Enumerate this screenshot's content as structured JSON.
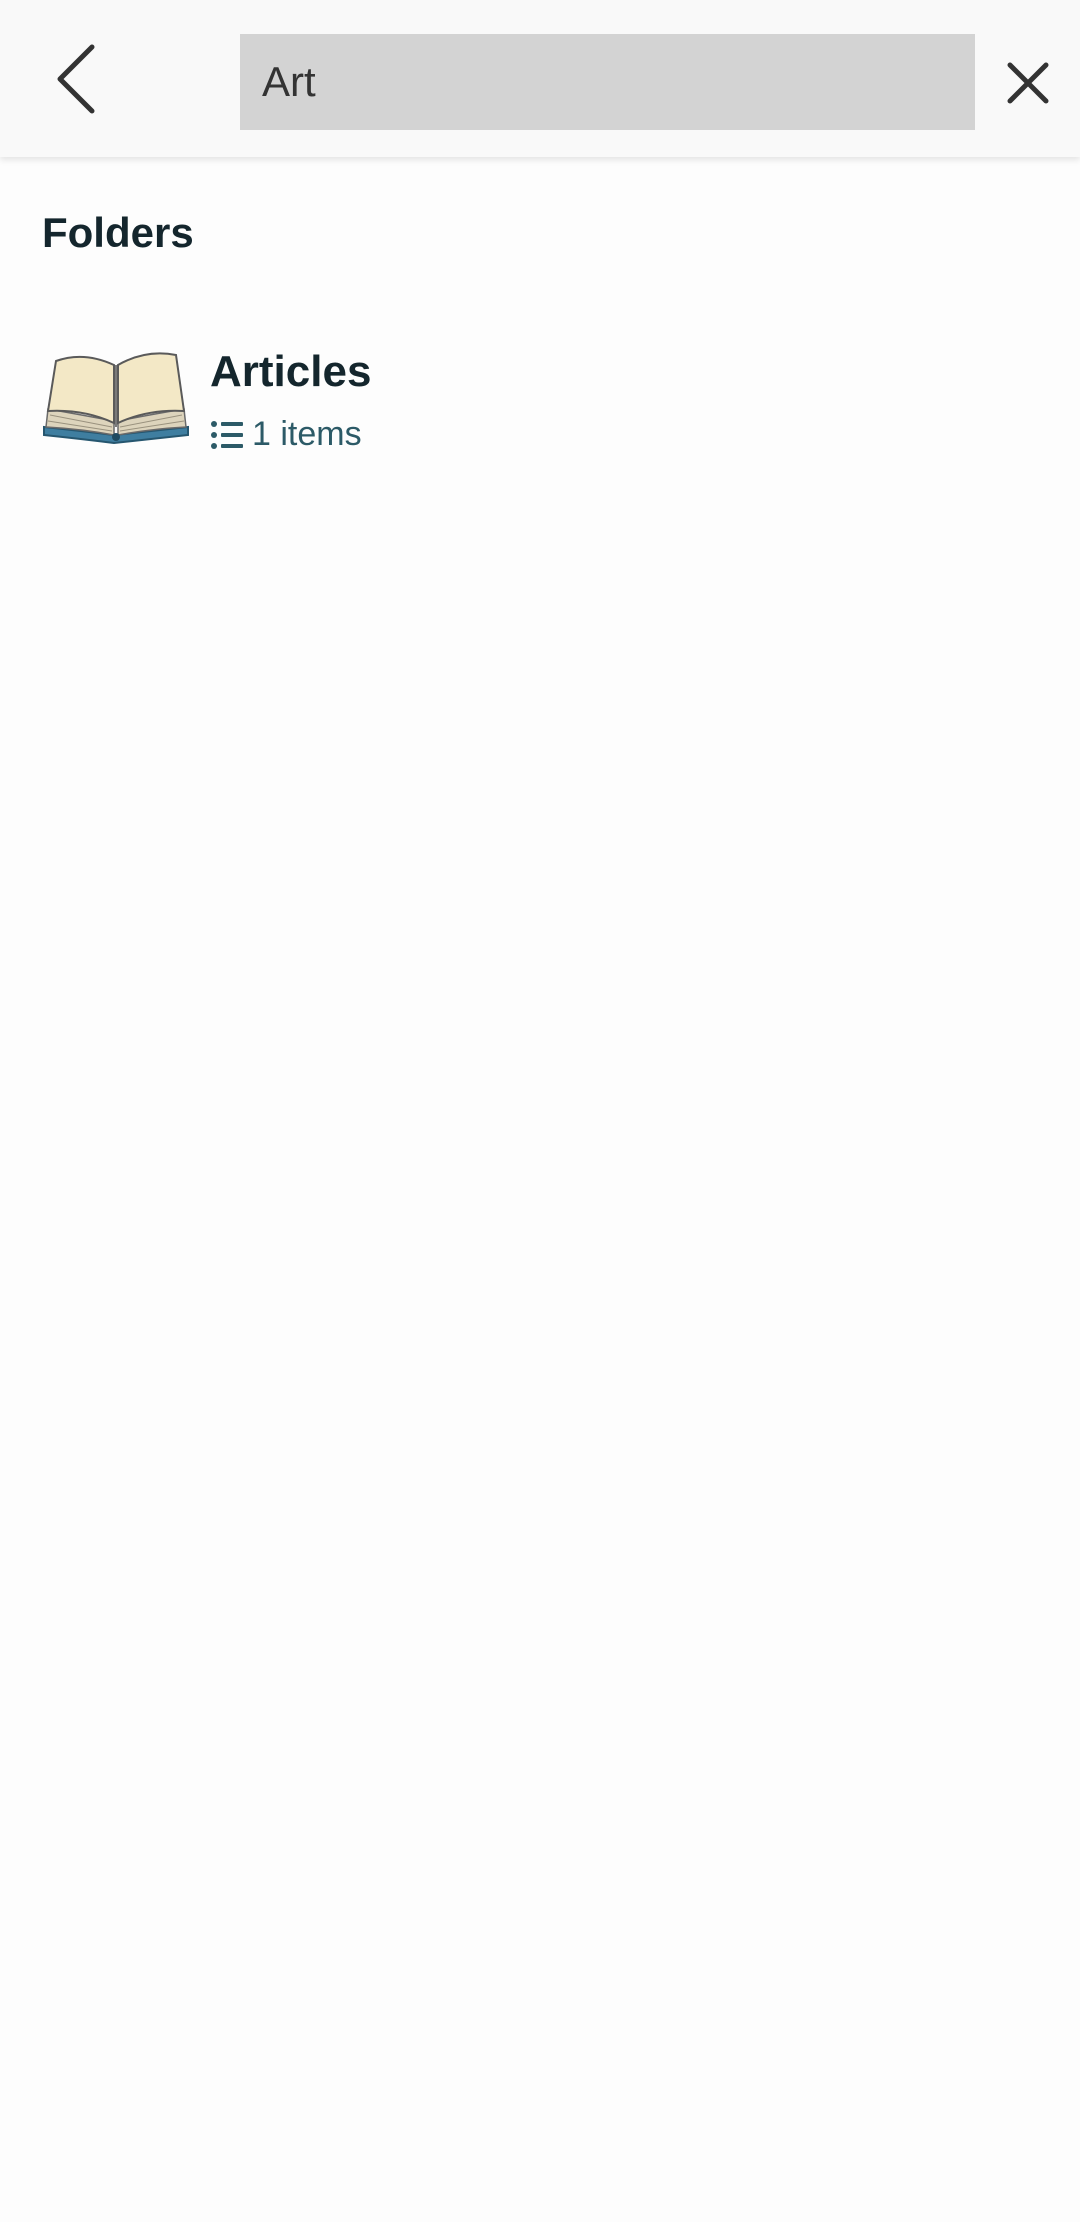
{
  "search": {
    "value": "Art",
    "back_icon": "chevron-left-icon",
    "clear_icon": "close-icon"
  },
  "folders": {
    "section_title": "Folders",
    "items": [
      {
        "name": "Articles",
        "count_label": "1 items",
        "thumbnail": "open-book-image",
        "meta_icon": "list-icon"
      }
    ]
  },
  "colors": {
    "top_bar_bg": "#f9f9f9",
    "search_bg": "#d3d3d3",
    "title_text": "#14262d",
    "meta_text": "#2c5a67"
  }
}
